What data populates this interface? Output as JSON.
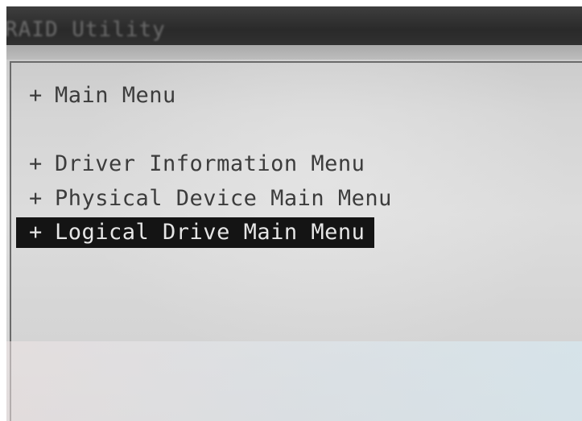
{
  "window": {
    "title": "RAID Utility"
  },
  "menu": {
    "bullet": "+",
    "items": [
      {
        "label": "Main Menu",
        "selected": false
      },
      {
        "label": "Driver Information Menu",
        "selected": false
      },
      {
        "label": "Physical Device Main Menu",
        "selected": false
      },
      {
        "label": "Logical Drive Main Menu",
        "selected": true
      }
    ]
  },
  "colors": {
    "selection_background": "#141414",
    "selection_text": "#e6e6e6",
    "menu_text": "#3c3c3c",
    "panel_background": "#d6d6d6",
    "title_bar_background": "#2f2f2f"
  }
}
